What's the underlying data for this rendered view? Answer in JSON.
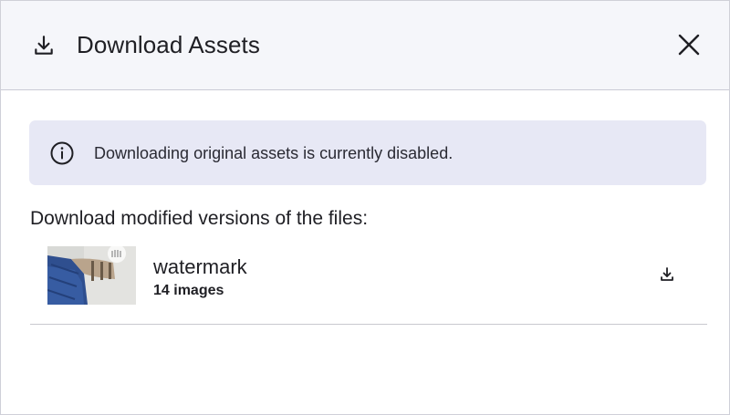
{
  "dialog": {
    "title": "Download Assets",
    "header_icon": "download-icon",
    "close_icon": "close-icon"
  },
  "banner": {
    "icon": "info-icon",
    "text": "Downloading original assets is currently disabled.",
    "background_color": "#e7e8f5"
  },
  "section": {
    "label": "Download modified versions of the files:"
  },
  "assets": [
    {
      "name": "watermark",
      "count": "14 images",
      "thumbnail": "watermark-thumbnail",
      "download_icon": "download-icon"
    }
  ],
  "colors": {
    "header_bg": "#f5f6fa",
    "text": "#1f1f24"
  }
}
